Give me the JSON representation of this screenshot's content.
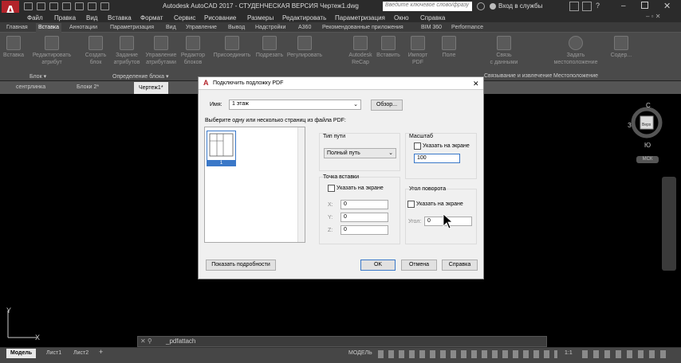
{
  "window": {
    "title": "Autodesk AutoCAD 2017 - СТУДЕНЧЕСКАЯ ВЕРСИЯ    Чертеж1.dwg",
    "search_placeholder": "Введите ключевое слово/фразу",
    "login": "Вход в службы"
  },
  "menu": [
    "Файл",
    "Правка",
    "Вид",
    "Вставка",
    "Формат",
    "Сервис",
    "Рисование",
    "Размеры",
    "Редактировать",
    "Параметризация",
    "Окно",
    "Справка"
  ],
  "ribbon_tabs": [
    "Главная",
    "Вставка",
    "Аннотации",
    "Параметризация",
    "Вид",
    "Управление",
    "Вывод",
    "Надстройки",
    "A360",
    "Рекомендованные приложения",
    "BIM 360",
    "Performance"
  ],
  "ribbon_active_tab": "Вставка",
  "ribbon_buttons": [
    {
      "label": "Вставка"
    },
    {
      "label": "Редактировать\nатрибут"
    },
    {
      "label": "Создать\nблок"
    },
    {
      "label": "Задание\nатрибутов"
    },
    {
      "label": "Управление\nатрибутами"
    },
    {
      "label": "Редактор\nблоков"
    },
    {
      "label": "Присоединить"
    },
    {
      "label": "Подрезать"
    },
    {
      "label": "Регулировать"
    },
    {
      "label": "Autodesk\nReCap"
    },
    {
      "label": "Вставить"
    },
    {
      "label": "Импорт\nPDF"
    },
    {
      "label": "Поле"
    },
    {
      "label": "Связь\nс данными"
    },
    {
      "label": "Задать\nместоположение"
    },
    {
      "label": "Содер..."
    }
  ],
  "ribbon_groups": [
    "Блок ▾",
    "Определение блока ▾",
    "Ссылка ▾",
    "Об...",
    "Связывание и извлечение",
    "Местоположение"
  ],
  "doc_tabs": [
    "сентрлинка",
    "Блоки 2*",
    "Чертеж1*"
  ],
  "doc_active": "Чертеж1*",
  "dialog": {
    "title": "Подключить подложку PDF",
    "name_label": "Имя:",
    "name_value": "1 этаж",
    "browse": "Обзор...",
    "pages_label": "Выберите одну или несколько страниц из файла PDF:",
    "page_number": "1",
    "path_type_label": "Тип пути",
    "path_type_value": "Полный путь",
    "scale_label": "Масштаб",
    "scale_on_screen": "Указать на экране",
    "scale_value": "100",
    "insertion_label": "Точка вставки",
    "insert_on_screen": "Указать на экране",
    "x_label": "X:",
    "x_value": "0",
    "y_label": "Y:",
    "y_value": "0",
    "z_label": "Z:",
    "z_value": "0",
    "rotation_label": "Угол поворота",
    "rotation_on_screen": "Указать на экране",
    "angle_label": "Угол:",
    "angle_value": "0",
    "details": "Показать подробности",
    "ok": "OK",
    "cancel": "Отмена",
    "help": "Справка"
  },
  "viewcube": {
    "n": "С",
    "s": "Ю",
    "w": "З",
    "top": "Верх",
    "wcs": "МСК"
  },
  "ucs": {
    "x": "X",
    "y": "Y"
  },
  "command_line": "_pdfattach",
  "layout_tabs": [
    "Модель",
    "Лист1",
    "Лист2"
  ],
  "status": {
    "model": "МОДЕЛЬ",
    "scale": "1:1"
  }
}
